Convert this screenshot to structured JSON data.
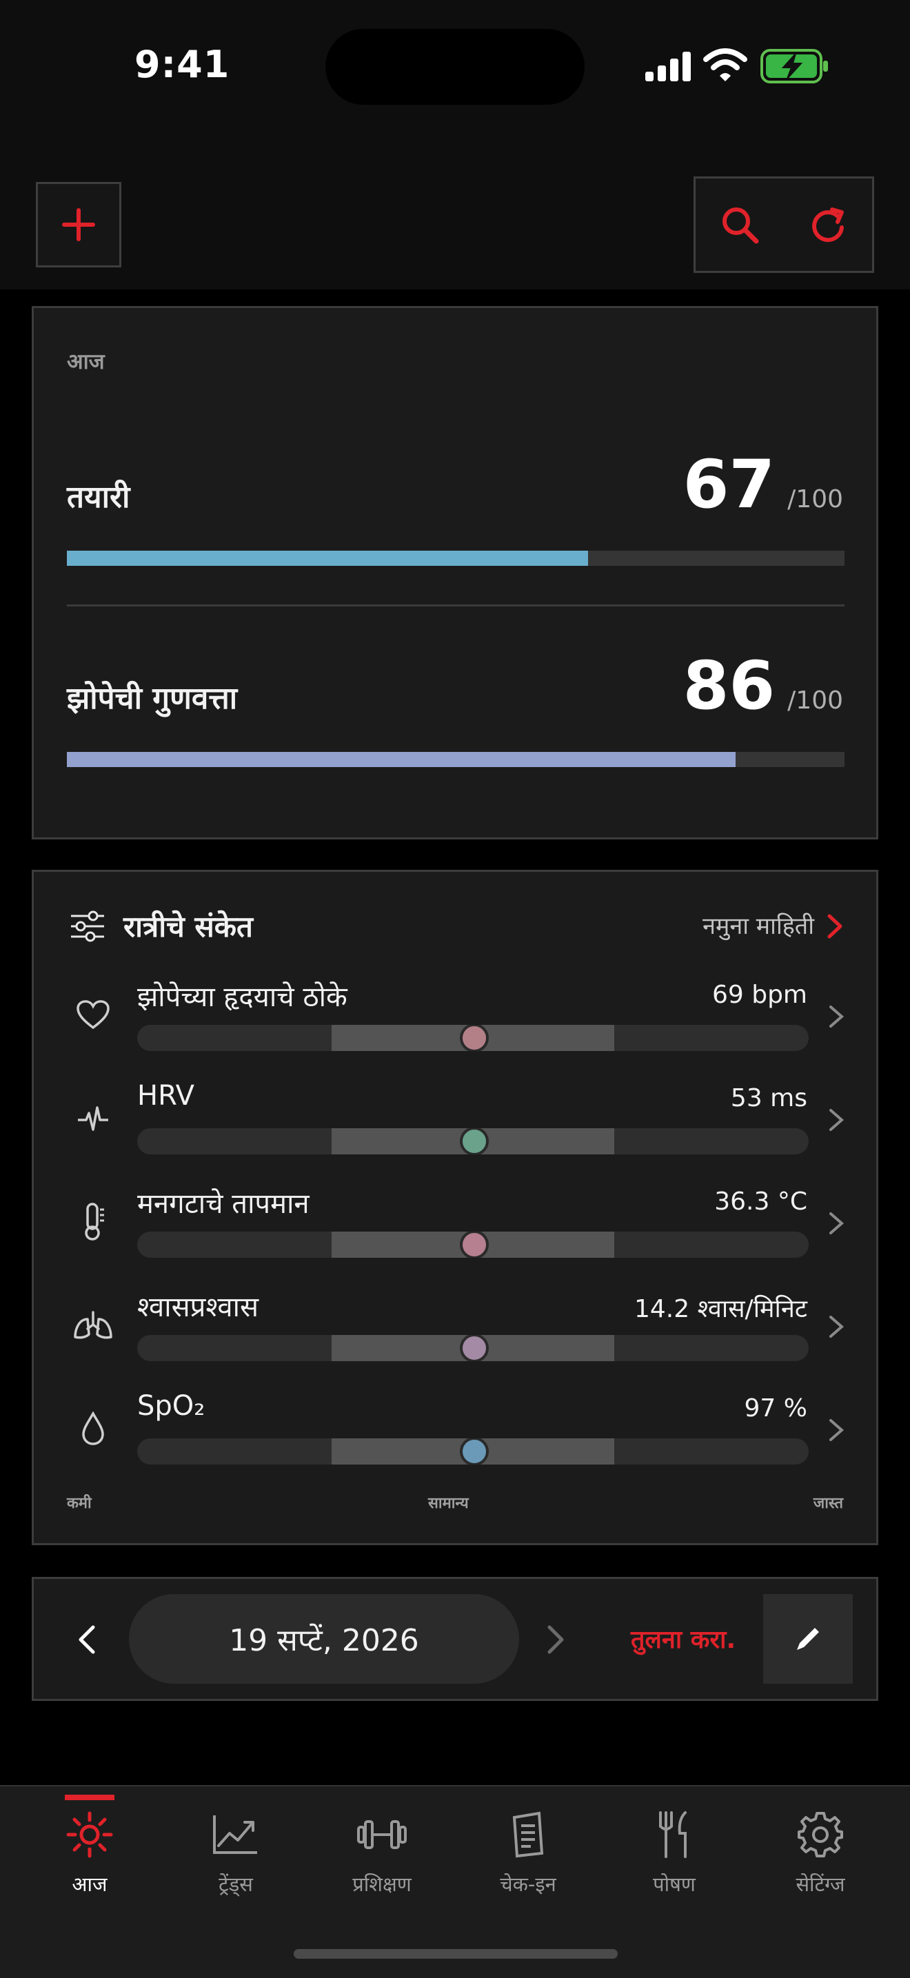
{
  "status": {
    "time": "9:41"
  },
  "today": {
    "label": "आज",
    "readiness": {
      "label": "तयारी",
      "value": "67",
      "max": "/100",
      "fraction": 0.67,
      "color": "#6aaecd"
    },
    "sleep": {
      "label": "झोपेची गुणवत्ता",
      "value": "86",
      "max": "/100",
      "fraction": 0.86,
      "color": "#93a1cf"
    }
  },
  "signals": {
    "title": "रात्रीचे संकेत",
    "sample_link": "नमुना माहिती",
    "rows": [
      {
        "icon": "heart-icon",
        "label": "झोपेच्या हृदयाचे ठोके",
        "value": "69 bpm",
        "dot_color": "#b48088"
      },
      {
        "icon": "pulse-icon",
        "label": "HRV",
        "value": "53 ms",
        "dot_color": "#6aa28c"
      },
      {
        "icon": "thermometer-icon",
        "label": "मनगटाचे तापमान",
        "value": "36.3 °C",
        "dot_color": "#b68090"
      },
      {
        "icon": "lungs-icon",
        "label": "श्वासप्रश्वास",
        "value": "14.2 श्वास/मिनिट",
        "dot_color": "#a48aa4"
      },
      {
        "icon": "drop-icon",
        "label": "SpO₂",
        "value": "97 %",
        "dot_color": "#6a9ab8"
      }
    ],
    "scale": {
      "low": "कमी",
      "normal": "सामान्य",
      "high": "जास्त"
    }
  },
  "date_nav": {
    "date": "19 सप्टें, 2026",
    "compare": "तुलना करा."
  },
  "tabs": [
    {
      "label": "आज",
      "icon": "sun-icon",
      "active": true
    },
    {
      "label": "ट्रेंड्स",
      "icon": "trend-chart-icon",
      "active": false
    },
    {
      "label": "प्रशिक्षण",
      "icon": "dumbbell-icon",
      "active": false
    },
    {
      "label": "चेक-इन",
      "icon": "notebook-icon",
      "active": false
    },
    {
      "label": "पोषण",
      "icon": "fork-knife-icon",
      "active": false
    },
    {
      "label": "सेटिंग्ज",
      "icon": "gear-icon",
      "active": false
    }
  ],
  "colors": {
    "accent": "#e0222a",
    "card": "#1b1b1b",
    "background": "#000000"
  }
}
